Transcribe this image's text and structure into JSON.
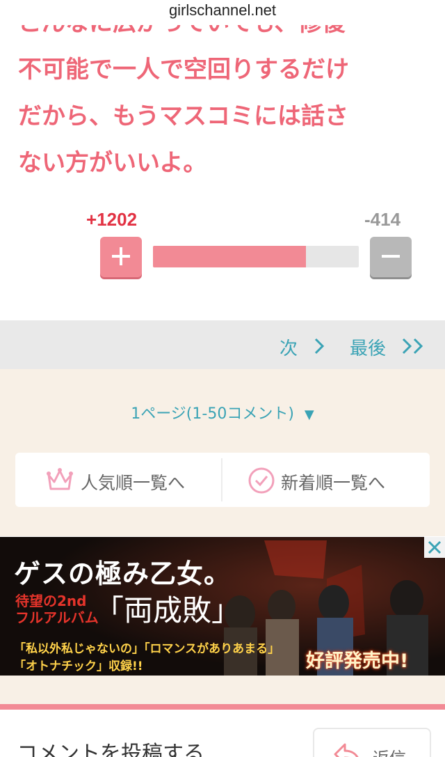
{
  "browser": {
    "url": "girlschannel.net"
  },
  "comment": {
    "lines": [
      "こんなに広がっていても、修復",
      "不可能で一人で空回りするだけ",
      "だから、もうマスコミには話さ",
      "ない方がいいよ。"
    ],
    "text_color": "#ee6677"
  },
  "votes": {
    "plus": "+1202",
    "minus": "-414",
    "plus_fraction": 0.744,
    "plus_color": "#f28a95",
    "minus_color": "#b8b8b8"
  },
  "pager": {
    "next_label": "次",
    "last_label": "最後"
  },
  "page_select": {
    "label": "1ページ(1-50コメント)",
    "arrow": "▼"
  },
  "sort": {
    "popular_label": "人気順一覧へ",
    "newest_label": "新着順一覧へ"
  },
  "ad": {
    "title": "ゲスの極み乙女。",
    "sub_line1": "待望の2nd",
    "sub_line2": "フルアルバム",
    "album": "「両成敗」",
    "songs_line1": "「私以外私じゃないの」「ロマンスがありあまる」",
    "songs_line2": "「オトナチック」収録!!",
    "sale": "好評発売中!"
  },
  "post": {
    "title": "コメントを投稿する",
    "reply_label": "返信"
  },
  "colors": {
    "accent": "#f28a95",
    "link": "#3aa3b5",
    "beige": "#f8f0e6"
  },
  "icons": {
    "plus": "plus-icon",
    "minus": "minus-icon",
    "next": "chevron-right-icon",
    "last": "double-chevron-right-icon",
    "popular": "crown-icon",
    "newest": "clock-icon",
    "close": "close-icon",
    "reply": "reply-icon",
    "dropdown": "triangle-down-icon"
  }
}
